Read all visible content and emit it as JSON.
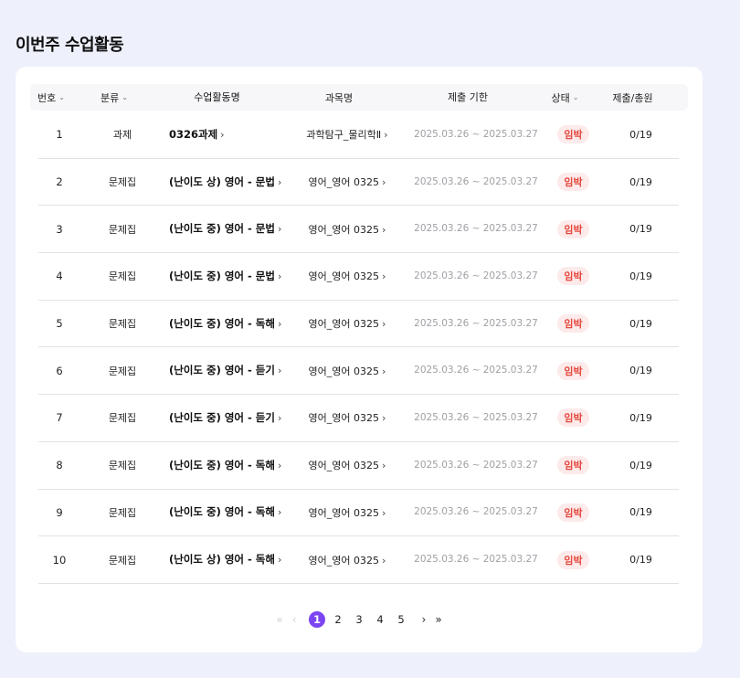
{
  "page_title": "이번주 수업활동",
  "table": {
    "headers": {
      "no": "번호",
      "category": "분류",
      "activity": "수업활동명",
      "subject": "과목명",
      "due": "제출 기한",
      "status": "상태",
      "submitted": "제출/총원"
    },
    "sort_icon": "chevron-down-icon",
    "rows": [
      {
        "no": "1",
        "category": "과제",
        "activity": "0326과제",
        "subject": "과학탐구_물리학Ⅱ",
        "due": "2025.03.26 ~ 2025.03.27",
        "status": "임박",
        "submitted": "0/19"
      },
      {
        "no": "2",
        "category": "문제집",
        "activity": "(난이도 상) 영어 - 문법",
        "subject": "영어_영어 0325",
        "due": "2025.03.26 ~ 2025.03.27",
        "status": "임박",
        "submitted": "0/19"
      },
      {
        "no": "3",
        "category": "문제집",
        "activity": "(난이도 중) 영어 - 문법",
        "subject": "영어_영어 0325",
        "due": "2025.03.26 ~ 2025.03.27",
        "status": "임박",
        "submitted": "0/19"
      },
      {
        "no": "4",
        "category": "문제집",
        "activity": "(난이도 중) 영어 - 문법",
        "subject": "영어_영어 0325",
        "due": "2025.03.26 ~ 2025.03.27",
        "status": "임박",
        "submitted": "0/19"
      },
      {
        "no": "5",
        "category": "문제집",
        "activity": "(난이도 중) 영어 - 독해",
        "subject": "영어_영어 0325",
        "due": "2025.03.26 ~ 2025.03.27",
        "status": "임박",
        "submitted": "0/19"
      },
      {
        "no": "6",
        "category": "문제집",
        "activity": "(난이도 중) 영어 - 듣기",
        "subject": "영어_영어 0325",
        "due": "2025.03.26 ~ 2025.03.27",
        "status": "임박",
        "submitted": "0/19"
      },
      {
        "no": "7",
        "category": "문제집",
        "activity": "(난이도 중) 영어 - 듣기",
        "subject": "영어_영어 0325",
        "due": "2025.03.26 ~ 2025.03.27",
        "status": "임박",
        "submitted": "0/19"
      },
      {
        "no": "8",
        "category": "문제집",
        "activity": "(난이도 중) 영어 - 독해",
        "subject": "영어_영어 0325",
        "due": "2025.03.26 ~ 2025.03.27",
        "status": "임박",
        "submitted": "0/19"
      },
      {
        "no": "9",
        "category": "문제집",
        "activity": "(난이도 중) 영어 - 독해",
        "subject": "영어_영어 0325",
        "due": "2025.03.26 ~ 2025.03.27",
        "status": "임박",
        "submitted": "0/19"
      },
      {
        "no": "10",
        "category": "문제집",
        "activity": "(난이도 상) 영어 - 독해",
        "subject": "영어_영어 0325",
        "due": "2025.03.26 ~ 2025.03.27",
        "status": "임박",
        "submitted": "0/19"
      }
    ]
  },
  "pagination": {
    "pages": [
      "1",
      "2",
      "3",
      "4",
      "5"
    ],
    "current": "1"
  },
  "colors": {
    "background": "#eef1fb",
    "accent": "#7b45f2",
    "status_text": "#e5483e",
    "status_bg": "#fdeaea"
  }
}
